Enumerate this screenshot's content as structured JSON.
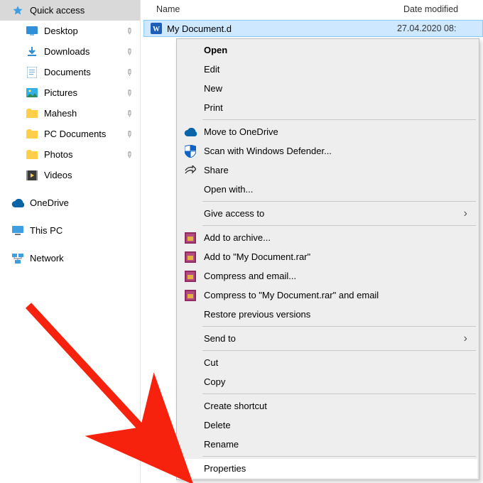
{
  "columns": {
    "name": "Name",
    "date": "Date modified"
  },
  "sidebar": {
    "quick_access": "Quick access",
    "desktop": "Desktop",
    "downloads": "Downloads",
    "documents": "Documents",
    "pictures": "Pictures",
    "mahesh": "Mahesh",
    "pc_documents": "PC Documents",
    "photos": "Photos",
    "videos": "Videos",
    "onedrive": "OneDrive",
    "this_pc": "This PC",
    "network": "Network"
  },
  "file": {
    "name": "My Document.d",
    "date": "27.04.2020 08:"
  },
  "menu": {
    "open": "Open",
    "edit": "Edit",
    "new": "New",
    "print": "Print",
    "move_onedrive": "Move to OneDrive",
    "scan_defender": "Scan with Windows Defender...",
    "share": "Share",
    "open_with": "Open with...",
    "give_access": "Give access to",
    "add_archive": "Add to archive...",
    "add_mydoc": "Add to \"My Document.rar\"",
    "compress_email": "Compress and email...",
    "compress_mydoc_email": "Compress to \"My Document.rar\" and email",
    "restore_versions": "Restore previous versions",
    "send_to": "Send to",
    "cut": "Cut",
    "copy": "Copy",
    "create_shortcut": "Create shortcut",
    "delete": "Delete",
    "rename": "Rename",
    "properties": "Properties"
  },
  "colors": {
    "selection": "#cde8ff",
    "menu_bg": "#eeeeee",
    "arrow": "#f6220d"
  }
}
